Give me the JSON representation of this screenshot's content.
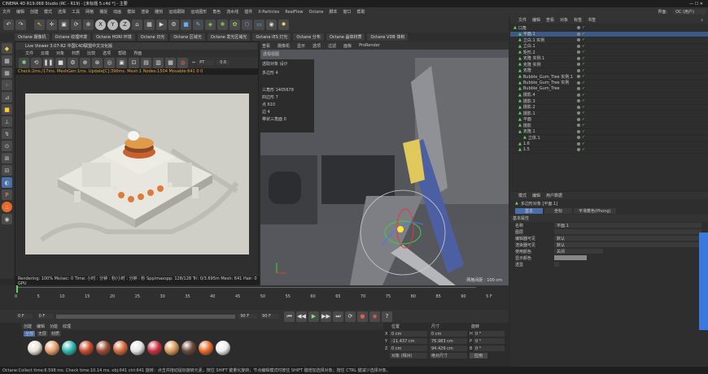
{
  "title": "CINEMA 4D R19.068 Studio (RC - R19) - [未标题 5.c4d *] - 主要",
  "layout_label": "界面:",
  "layout_value": "OC (用户)",
  "menu": [
    "文件",
    "编辑",
    "创建",
    "模式",
    "选择",
    "工具",
    "网格",
    "捕捉",
    "动画",
    "模拟",
    "渲染",
    "雕刻",
    "运动跟踪",
    "运动图形",
    "角色",
    "流水线",
    "插件",
    "X-Particles",
    "RealFlow",
    "Octane",
    "脚本",
    "窗口",
    "帮助"
  ],
  "octane_tabs": [
    "Octane 摄像机",
    "Octane 纹理环境",
    "Octane HDRI 环境",
    "Octane 日光",
    "Octane 区域光",
    "Octane 发光区域光",
    "Octane IES 灯光",
    "Octane 分布",
    "Octane 晶体材质",
    "Octane VDB 体积"
  ],
  "live_viewer": {
    "title": "Live Viewer 3.07-R2 中国C4D联盟中文汉化版",
    "menu": [
      "文件",
      "云端",
      "对象",
      "材质",
      "比较",
      "选项",
      "帮助",
      "界面"
    ],
    "mode": "PT",
    "exposure": "0.6",
    "stats": "Check:2ms./17ms. MeshGen:1ms. Update[C]:396ms. Mesh:1 Nodes:1504 Movable:641  0 0",
    "footer": "Rendering: 100%  Ms/sec: 0  Time: 小时 : 分钟 : 秒/小时 : 分钟 : 秒   Spp/maxspp: 128/128   Tri: 0/3.695m  Mesh: 641  Hair: 0   GPU"
  },
  "viewport": {
    "tabs": [
      "查看",
      "摄像机",
      "显示",
      "选项",
      "过滤",
      "面板",
      "ProRender"
    ],
    "label": "透视视图",
    "hud_title": "选取对象 设计",
    "hud_rows": [
      {
        "k": "多边形",
        "v": "4"
      },
      {
        "k": "三角形",
        "v": "1405678"
      },
      {
        "k": "四边形",
        "v": "7"
      },
      {
        "k": "点",
        "v": "610"
      },
      {
        "k": "边",
        "v": "4"
      },
      {
        "k": "带状三角面",
        "v": "0"
      }
    ],
    "grid_text": "网格间距 : 100 cm"
  },
  "timeline": {
    "ticks": [
      "0",
      "5",
      "10",
      "15",
      "20",
      "25",
      "30",
      "35",
      "40",
      "45",
      "50",
      "55",
      "60",
      "65",
      "70",
      "75",
      "80",
      "85",
      "90"
    ],
    "frame_end": "5 F",
    "current": "0 F",
    "start": "0 F",
    "end": "90 F",
    "end2": "90 F"
  },
  "material": {
    "menu": [
      "创建",
      "编辑",
      "功能",
      "纹理"
    ],
    "tabs": [
      "全部",
      "无层",
      "材质"
    ],
    "colors": [
      "#e8e2d6",
      "#e4a06a",
      "#2fb8b0",
      "#c94a2c",
      "#9a4a32",
      "#d46a3a",
      "#e4e4e4",
      "#c93040",
      "#d99a5a",
      "#6a4a3a",
      "#e86a2a",
      "#eeeeee"
    ]
  },
  "coordinates": {
    "headers": [
      "位置",
      "尺寸",
      "旋转"
    ],
    "rows": [
      {
        "axis": "X",
        "pos": "0 cm",
        "size": "0 cm",
        "rot_axis": "H",
        "rot": "0 °"
      },
      {
        "axis": "Y",
        "pos": "-11.437 cm",
        "size": "76.983 cm",
        "rot_axis": "P",
        "rot": "0 °"
      },
      {
        "axis": "Z",
        "pos": "0 cm",
        "size": "94.429 cm",
        "rot_axis": "B",
        "rot": "0 °"
      }
    ],
    "mode1": "对象 (相对)",
    "mode2": "绝对尺寸",
    "apply": "应用"
  },
  "object_manager": {
    "menu": [
      "文件",
      "编辑",
      "查看",
      "对象",
      "标签",
      "书签"
    ],
    "objects": [
      {
        "name": "口角",
        "indent": 0
      },
      {
        "name": "平面.1",
        "indent": 1,
        "selected": true
      },
      {
        "name": "立白.1 实例",
        "indent": 1
      },
      {
        "name": "立白.1",
        "indent": 1
      },
      {
        "name": "矩形.2",
        "indent": 1
      },
      {
        "name": "克隆 实例.1",
        "indent": 1
      },
      {
        "name": "克隆 实例",
        "indent": 1
      },
      {
        "name": "克隆",
        "indent": 1
      },
      {
        "name": "Bubble_Gum_Tree 实例.1",
        "indent": 1
      },
      {
        "name": "Bubble_Gum_Tree 实例",
        "indent": 1
      },
      {
        "name": "Bubble_Gum_Tree",
        "indent": 1
      },
      {
        "name": "摄影.4",
        "indent": 1
      },
      {
        "name": "摄影.3",
        "indent": 1
      },
      {
        "name": "摄影.2",
        "indent": 1
      },
      {
        "name": "摄影.1",
        "indent": 1
      },
      {
        "name": "平面",
        "indent": 1
      },
      {
        "name": "摄影",
        "indent": 1
      },
      {
        "name": "克隆.1",
        "indent": 1
      },
      {
        "name": "立体.1",
        "indent": 2
      },
      {
        "name": "1.6",
        "indent": 1
      },
      {
        "name": "1.5",
        "indent": 1
      }
    ]
  },
  "attribute_manager": {
    "menu": [
      "模式",
      "编辑",
      "用户数据"
    ],
    "title": "多边形对象 [平面.1]",
    "tabs": [
      "基本",
      "坐标",
      "平滑着色(Phong)"
    ],
    "section": "基本属性",
    "rows": [
      {
        "label": "名称",
        "value": "平面.1"
      },
      {
        "label": "图层",
        "value": ""
      },
      {
        "label": "编辑器可见",
        "value": "默认"
      },
      {
        "label": "渲染器可见",
        "value": "默认"
      },
      {
        "label": "使用颜色",
        "value": "关闭"
      },
      {
        "label": "显示颜色",
        "value": ""
      },
      {
        "label": "透显",
        "value": ""
      }
    ]
  },
  "status": "Octane:Collect time:6.598 ms. Check time:10.14 ms. obj:641 ctri:641   旋转：点击并拖动鼠标旋转元素，按住 SHIFT 键量化旋转；节点编辑模式时按住 SHIFT 键增加选择对象；按住 CTRL 键减少选择对象。"
}
